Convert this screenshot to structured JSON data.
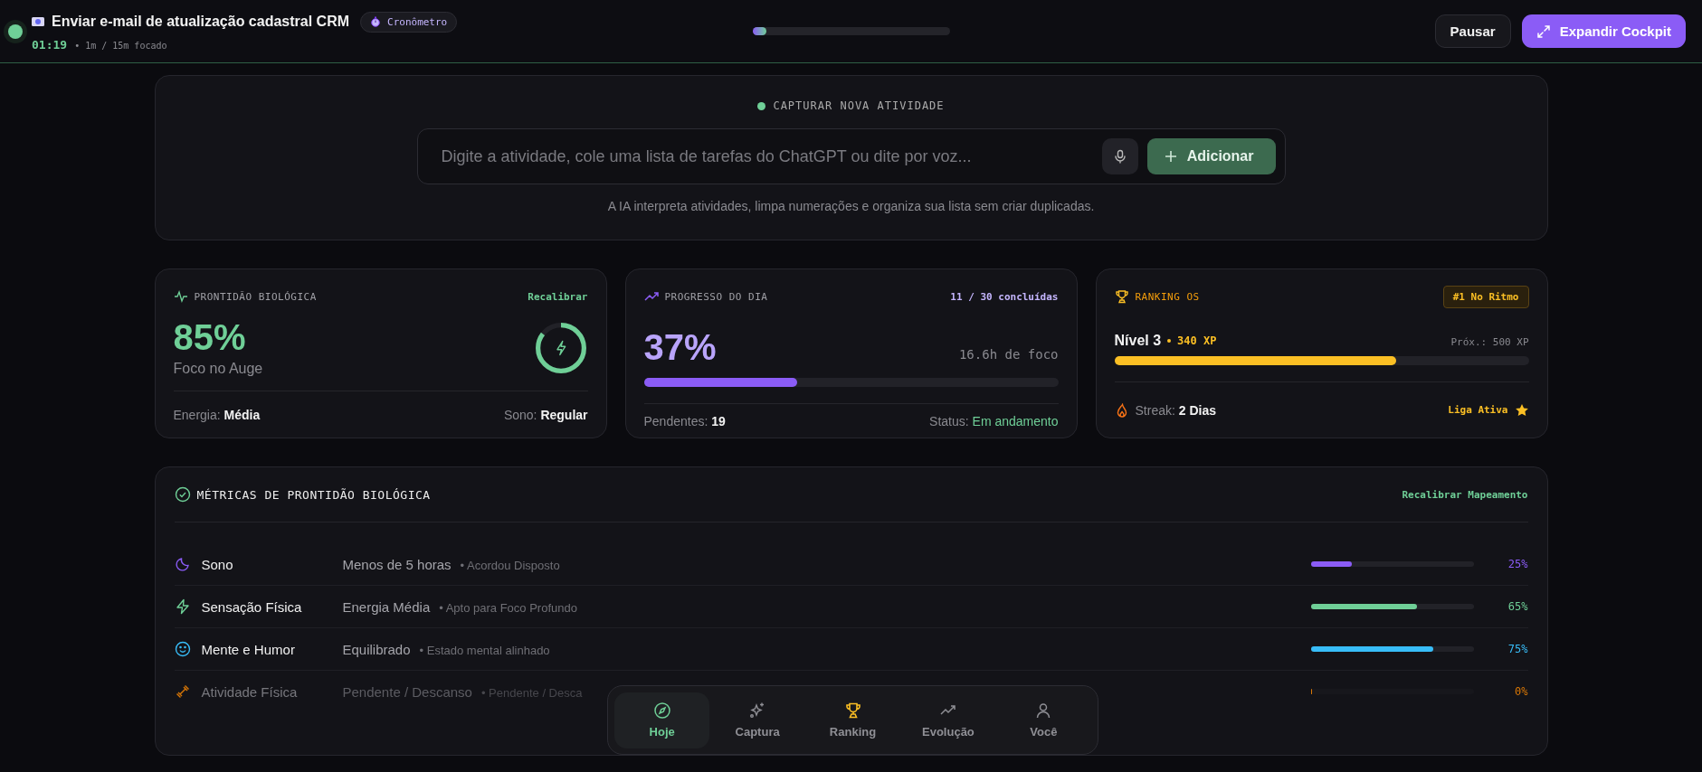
{
  "header": {
    "task_title": "Enviar e-mail de atualização cadastral CRM",
    "mode_badge": "Cronômetro",
    "elapsed": "01:19",
    "focus_note": "• 1m / 15m focado",
    "progress": {
      "level": 0.07
    },
    "buttons": [
      {
        "label": "Pausar",
        "kind": "secondary"
      },
      {
        "label": "Expandir Cockpit",
        "kind": "primary"
      }
    ]
  },
  "capture": {
    "title": "CAPTURAR NOVA ATIVIDADE",
    "input": {
      "placeholder": "Digite a atividade, cole uma lista de tarefas do ChatGPT ou dite por voz..."
    },
    "add_button": "Adicionar",
    "hint": "A IA interpreta atividades, limpa numerações e organiza sua lista sem criar duplicadas."
  },
  "readiness": {
    "title": "PRONTIDÃO BIOLÓGICA",
    "action": "Recalibrar",
    "value": "85%",
    "status": "Foco no Auge",
    "ring": {
      "level": 0.85
    },
    "footer": [
      {
        "label": "Energia:",
        "value": "Média"
      },
      {
        "label": "Sono:",
        "value": "Regular"
      }
    ]
  },
  "progress_card": {
    "title": "PROGRESSO DO DIA",
    "count": "11 / 30 concluídas",
    "value": "37%",
    "focus": "16.6h de foco",
    "bar": {
      "level": 0.37
    },
    "footer": [
      {
        "label": "Pendentes:",
        "value": "19",
        "kind": "plain"
      },
      {
        "label": "Status:",
        "value": "Em andamento",
        "kind": "status"
      }
    ]
  },
  "ranking": {
    "title": "RANKING OS",
    "badge": "#1 No Ritmo",
    "level_label": "Nível 3",
    "xp": "340 XP",
    "next": "Próx.: 500 XP",
    "bar": {
      "level": 0.68
    },
    "streak_label": "Streak:",
    "streak_value": "2 Dias",
    "league": "Liga Ativa"
  },
  "metrics": {
    "title": "MÉTRICAS DE PRONTIDÃO BIOLÓGICA",
    "action": "Recalibrar Mapeamento",
    "rows": [
      {
        "kind": "sleep",
        "name": "Sono",
        "value": "Menos de 5 horas",
        "note": "• Acordou Disposto",
        "level": 0.25,
        "reading": "25%",
        "color": "#8b5cf6"
      },
      {
        "kind": "body",
        "name": "Sensação Física",
        "value": "Energia Média",
        "note": "• Apto para Foco Profundo",
        "level": 0.65,
        "reading": "65%",
        "color": "#6fcf97"
      },
      {
        "kind": "mind",
        "name": "Mente e Humor",
        "value": "Equilibrado",
        "note": "• Estado mental alinhado",
        "level": 0.75,
        "reading": "75%",
        "color": "#38bdf8"
      },
      {
        "kind": "activity",
        "name": "Atividade Física",
        "value": "Pendente / Descanso",
        "note": "• Pendente / Desca",
        "level": 0,
        "reading": "0%",
        "color": "#d97706"
      }
    ]
  },
  "nav": [
    {
      "kind": "today",
      "label": "Hoje",
      "selected": true
    },
    {
      "kind": "capture",
      "label": "Captura",
      "selected": false
    },
    {
      "kind": "ranking",
      "label": "Ranking",
      "selected": false
    },
    {
      "kind": "evolution",
      "label": "Evolução",
      "selected": false
    },
    {
      "kind": "profile",
      "label": "Você",
      "selected": false
    }
  ]
}
